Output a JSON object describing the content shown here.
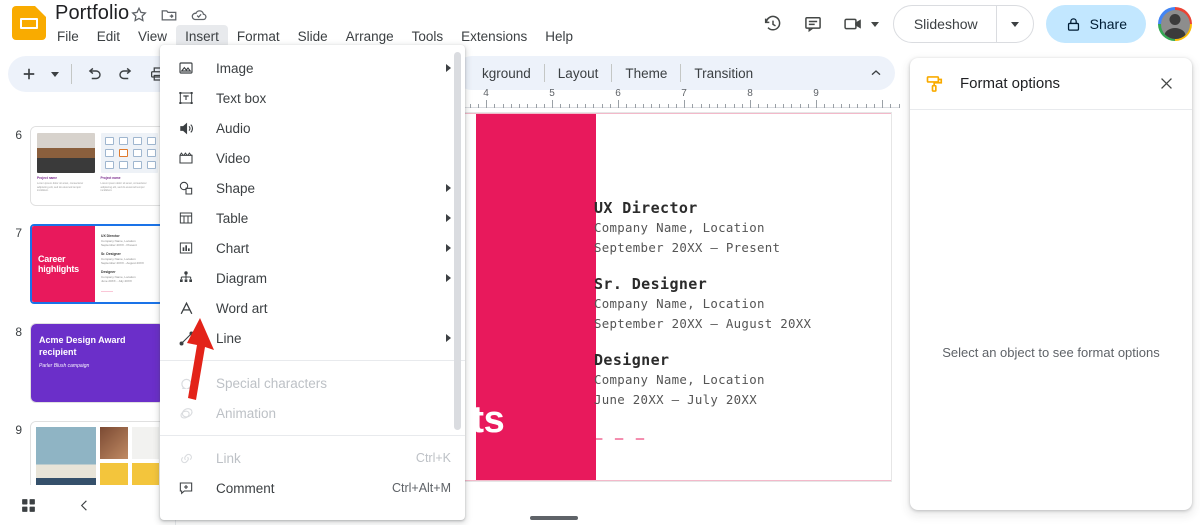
{
  "app": {
    "doc_title": "Portfolio",
    "doc_icon": "slides-icon",
    "title_actions": [
      "star-icon",
      "move-to-folder-icon",
      "cloud-saved-icon"
    ],
    "menubar": [
      {
        "label": "File",
        "active": false
      },
      {
        "label": "Edit",
        "active": false
      },
      {
        "label": "View",
        "active": false
      },
      {
        "label": "Insert",
        "active": true
      },
      {
        "label": "Format",
        "active": false
      },
      {
        "label": "Slide",
        "active": false
      },
      {
        "label": "Arrange",
        "active": false
      },
      {
        "label": "Tools",
        "active": false
      },
      {
        "label": "Extensions",
        "active": false
      },
      {
        "label": "Help",
        "active": false
      }
    ],
    "top_right": {
      "history_icon": "version-history-icon",
      "comment_icon": "comment-icon",
      "meet_icon": "video-camera-icon",
      "meet_caret": "chevron-down-icon",
      "slideshow_label": "Slideshow",
      "slideshow_caret": "chevron-down-icon",
      "share_label": "Share",
      "share_icon": "lock-icon",
      "share_bg": "#C2E7FF",
      "avatar": "user-avatar"
    }
  },
  "toolbar": {
    "left": [
      {
        "name": "new-slide-button",
        "icon": "plus-icon"
      },
      {
        "name": "new-slide-dropdown",
        "icon": "chevron-down-icon"
      },
      {
        "name": "undo-button",
        "icon": "undo-icon"
      },
      {
        "name": "redo-button",
        "icon": "redo-icon"
      },
      {
        "name": "print-button",
        "icon": "print-icon"
      }
    ],
    "right_items": [
      "kground",
      "Layout",
      "Theme",
      "Transition"
    ],
    "first_item_full": "Background",
    "collapse_icon": "chevron-up-icon"
  },
  "insert_menu": {
    "items": [
      {
        "label": "Image",
        "icon": "image-icon",
        "submenu": true,
        "disabled": false,
        "shortcut": ""
      },
      {
        "label": "Text box",
        "icon": "text-box-icon",
        "submenu": false,
        "disabled": false,
        "shortcut": ""
      },
      {
        "label": "Audio",
        "icon": "audio-icon",
        "submenu": false,
        "disabled": false,
        "shortcut": ""
      },
      {
        "label": "Video",
        "icon": "video-icon",
        "submenu": false,
        "disabled": false,
        "shortcut": ""
      },
      {
        "label": "Shape",
        "icon": "shape-icon",
        "submenu": true,
        "disabled": false,
        "shortcut": ""
      },
      {
        "label": "Table",
        "icon": "table-icon",
        "submenu": true,
        "disabled": false,
        "shortcut": ""
      },
      {
        "label": "Chart",
        "icon": "chart-icon",
        "submenu": true,
        "disabled": false,
        "shortcut": ""
      },
      {
        "label": "Diagram",
        "icon": "diagram-icon",
        "submenu": true,
        "disabled": false,
        "shortcut": ""
      },
      {
        "label": "Word art",
        "icon": "word-art-icon",
        "submenu": false,
        "disabled": false,
        "shortcut": ""
      },
      {
        "label": "Line",
        "icon": "line-icon",
        "submenu": true,
        "disabled": false,
        "shortcut": ""
      },
      {
        "label": "Special characters",
        "icon": "omega-icon",
        "submenu": false,
        "disabled": true,
        "shortcut": ""
      },
      {
        "label": "Animation",
        "icon": "animation-icon",
        "submenu": false,
        "disabled": true,
        "shortcut": ""
      },
      {
        "label": "Link",
        "icon": "link-icon",
        "submenu": false,
        "disabled": true,
        "shortcut": "Ctrl+K"
      },
      {
        "label": "Comment",
        "icon": "comment-plus-icon",
        "submenu": false,
        "disabled": false,
        "shortcut": "Ctrl+Alt+M"
      }
    ],
    "separators_after": [
      9,
      11
    ],
    "annotation": {
      "type": "red-arrow",
      "points_at": "Word art",
      "color": "#E32319"
    }
  },
  "thumbnails": [
    {
      "number": "6",
      "selected": false,
      "kind": "projects",
      "caption1": "Project name",
      "caption2": "Project name"
    },
    {
      "number": "7",
      "selected": true,
      "kind": "career",
      "title": "Career highlights",
      "jobs": [
        {
          "role": "UX Director",
          "company": "Company Name, Location",
          "dates": "September 20XX - Present"
        },
        {
          "role": "Sr. Designer",
          "company": "Company Name, Location",
          "dates": "September 20XX - August 20XX"
        },
        {
          "role": "Designer",
          "company": "Company Name, Location",
          "dates": "June 20XX - July 20XX"
        }
      ]
    },
    {
      "number": "8",
      "selected": false,
      "kind": "award",
      "title": "Acme Design Award recipient",
      "subtitle": "Parler Blush campaign"
    },
    {
      "number": "9",
      "selected": false,
      "kind": "gallery"
    }
  ],
  "panel_bottom": {
    "grid_view_icon": "grid-view-icon",
    "collapse_icon": "chevron-left-icon"
  },
  "ruler": {
    "labels": [
      "4",
      "5",
      "6",
      "7",
      "8",
      "9"
    ],
    "unit": "inches"
  },
  "slide": {
    "accent_color": "#E8195C",
    "title_visible_text": "ghts",
    "title_full_text": "Career highlights",
    "jobs": [
      {
        "role": "UX Director",
        "company": "Company Name, Location",
        "dates": "September 20XX – Present"
      },
      {
        "role": "Sr. Designer",
        "company": "Company Name, Location",
        "dates": "September 20XX – August 20XX"
      },
      {
        "role": "Designer",
        "company": "Company Name, Location",
        "dates": "June 20XX – July 20XX"
      }
    ],
    "footer_dashes": "— — —"
  },
  "format_panel": {
    "title": "Format options",
    "icon": "paint-roller-icon",
    "close_icon": "close-icon",
    "empty_message": "Select an object to see format options"
  }
}
